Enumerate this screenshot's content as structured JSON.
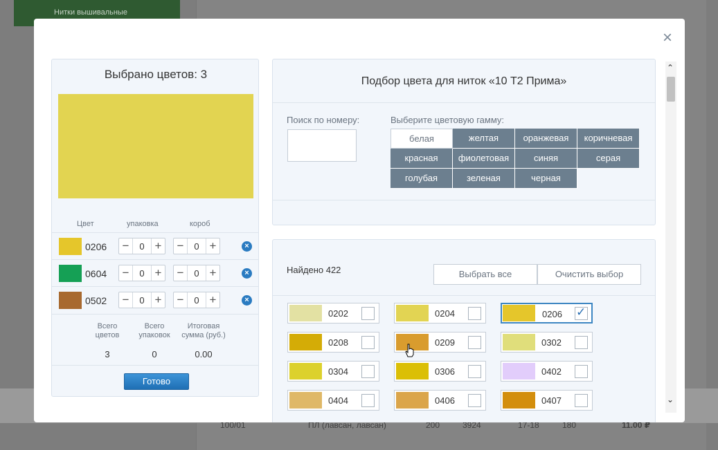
{
  "background": {
    "sidebar_item": "Нитки вышивальные",
    "row": {
      "num": "100/01",
      "desc": "ПЛ (лавсан, лавсан)",
      "pack": "200",
      "code": "3924",
      "size": "17-18",
      "qty": "180",
      "price": "11.00 ₽"
    }
  },
  "modal": {
    "close_label": "×",
    "left": {
      "title": "Выбрано цветов: 3",
      "big_swatch_color": "#e2d451",
      "columns": {
        "color": "Цвет",
        "pack": "упаковка",
        "box": "короб"
      },
      "selected": [
        {
          "code": "0206",
          "color": "#e5c62b",
          "pack": "0",
          "box": "0"
        },
        {
          "code": "0604",
          "color": "#15a055",
          "pack": "0",
          "box": "0"
        },
        {
          "code": "0502",
          "color": "#a8692f",
          "pack": "0",
          "box": "0"
        }
      ],
      "stepper": {
        "minus": "−",
        "plus": "+"
      },
      "totals": {
        "colors_label": "Всего цветов",
        "packs_label": "Всего упаковок",
        "sum_label": "Итоговая сумма (руб.)",
        "colors_value": "3",
        "packs_value": "0",
        "sum_value": "0.00"
      },
      "done_label": "Готово"
    },
    "right_top": {
      "title": "Подбор цвета для ниток «10 Т2 Прима»",
      "search_label": "Поиск по номеру:",
      "search_value": "",
      "gamma_label": "Выберите цветовую гамму:",
      "gamma": [
        {
          "label": "белая",
          "active": true
        },
        {
          "label": "желтая"
        },
        {
          "label": "оранжевая"
        },
        {
          "label": "коричневая"
        },
        {
          "label": "красная"
        },
        {
          "label": "фиолетовая"
        },
        {
          "label": "синяя"
        },
        {
          "label": "серая"
        },
        {
          "label": "голубая"
        },
        {
          "label": "зеленая"
        },
        {
          "label": "черная"
        }
      ]
    },
    "right_bottom": {
      "found": "Найдено 422",
      "select_all": "Выбрать все",
      "clear": "Очистить выбор",
      "tiles": [
        {
          "code": "0202",
          "color": "#e3e1a3",
          "selected": false
        },
        {
          "code": "0204",
          "color": "#e2d453",
          "selected": false
        },
        {
          "code": "0206",
          "color": "#e5c62b",
          "selected": true
        },
        {
          "code": "0208",
          "color": "#d4ac06",
          "selected": false
        },
        {
          "code": "0209",
          "color": "#d99c2e",
          "selected": false
        },
        {
          "code": "0302",
          "color": "#e0de7b",
          "selected": false
        },
        {
          "code": "0304",
          "color": "#dcd12c",
          "selected": false
        },
        {
          "code": "0306",
          "color": "#dbbf06",
          "selected": false
        },
        {
          "code": "0402",
          "color": "#e2cdfb",
          "selected": false
        },
        {
          "code": "0404",
          "color": "#dfb867",
          "selected": false
        },
        {
          "code": "0406",
          "color": "#dba54a",
          "selected": false
        },
        {
          "code": "0407",
          "color": "#d38e0d",
          "selected": false
        }
      ],
      "check_mark": "✓"
    },
    "scrollbar": {
      "up": "⌃",
      "down": "⌄"
    }
  }
}
